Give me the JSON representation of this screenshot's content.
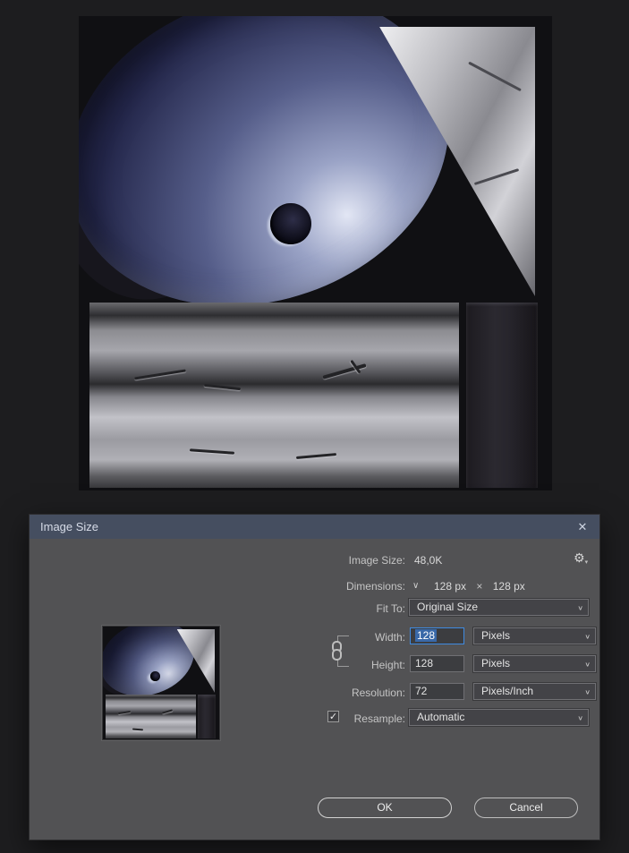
{
  "dialog": {
    "title": "Image Size",
    "image_size": {
      "label": "Image Size:",
      "value": "48,0K"
    },
    "dimensions": {
      "label": "Dimensions:",
      "width": "128 px",
      "times": "×",
      "height": "128 px"
    },
    "fit_to": {
      "label": "Fit To:",
      "value": "Original Size"
    },
    "width": {
      "label": "Width:",
      "value": "128",
      "unit": "Pixels"
    },
    "height": {
      "label": "Height:",
      "value": "128",
      "unit": "Pixels"
    },
    "resolution": {
      "label": "Resolution:",
      "value": "72",
      "unit": "Pixels/Inch"
    },
    "resample": {
      "label": "Resample:",
      "checked": true,
      "value": "Automatic"
    },
    "buttons": {
      "ok": "OK",
      "cancel": "Cancel"
    }
  },
  "icons": {
    "close": "✕",
    "gear": "⚙",
    "gear_caret": "▾",
    "chevron": "∨",
    "check": "✓"
  },
  "colors": {
    "accent": "#3f8ae0",
    "selection": "#3a69a8",
    "titlebar": "#454e60",
    "dialog_bg": "#525254",
    "canvas_bg": "#101013"
  }
}
